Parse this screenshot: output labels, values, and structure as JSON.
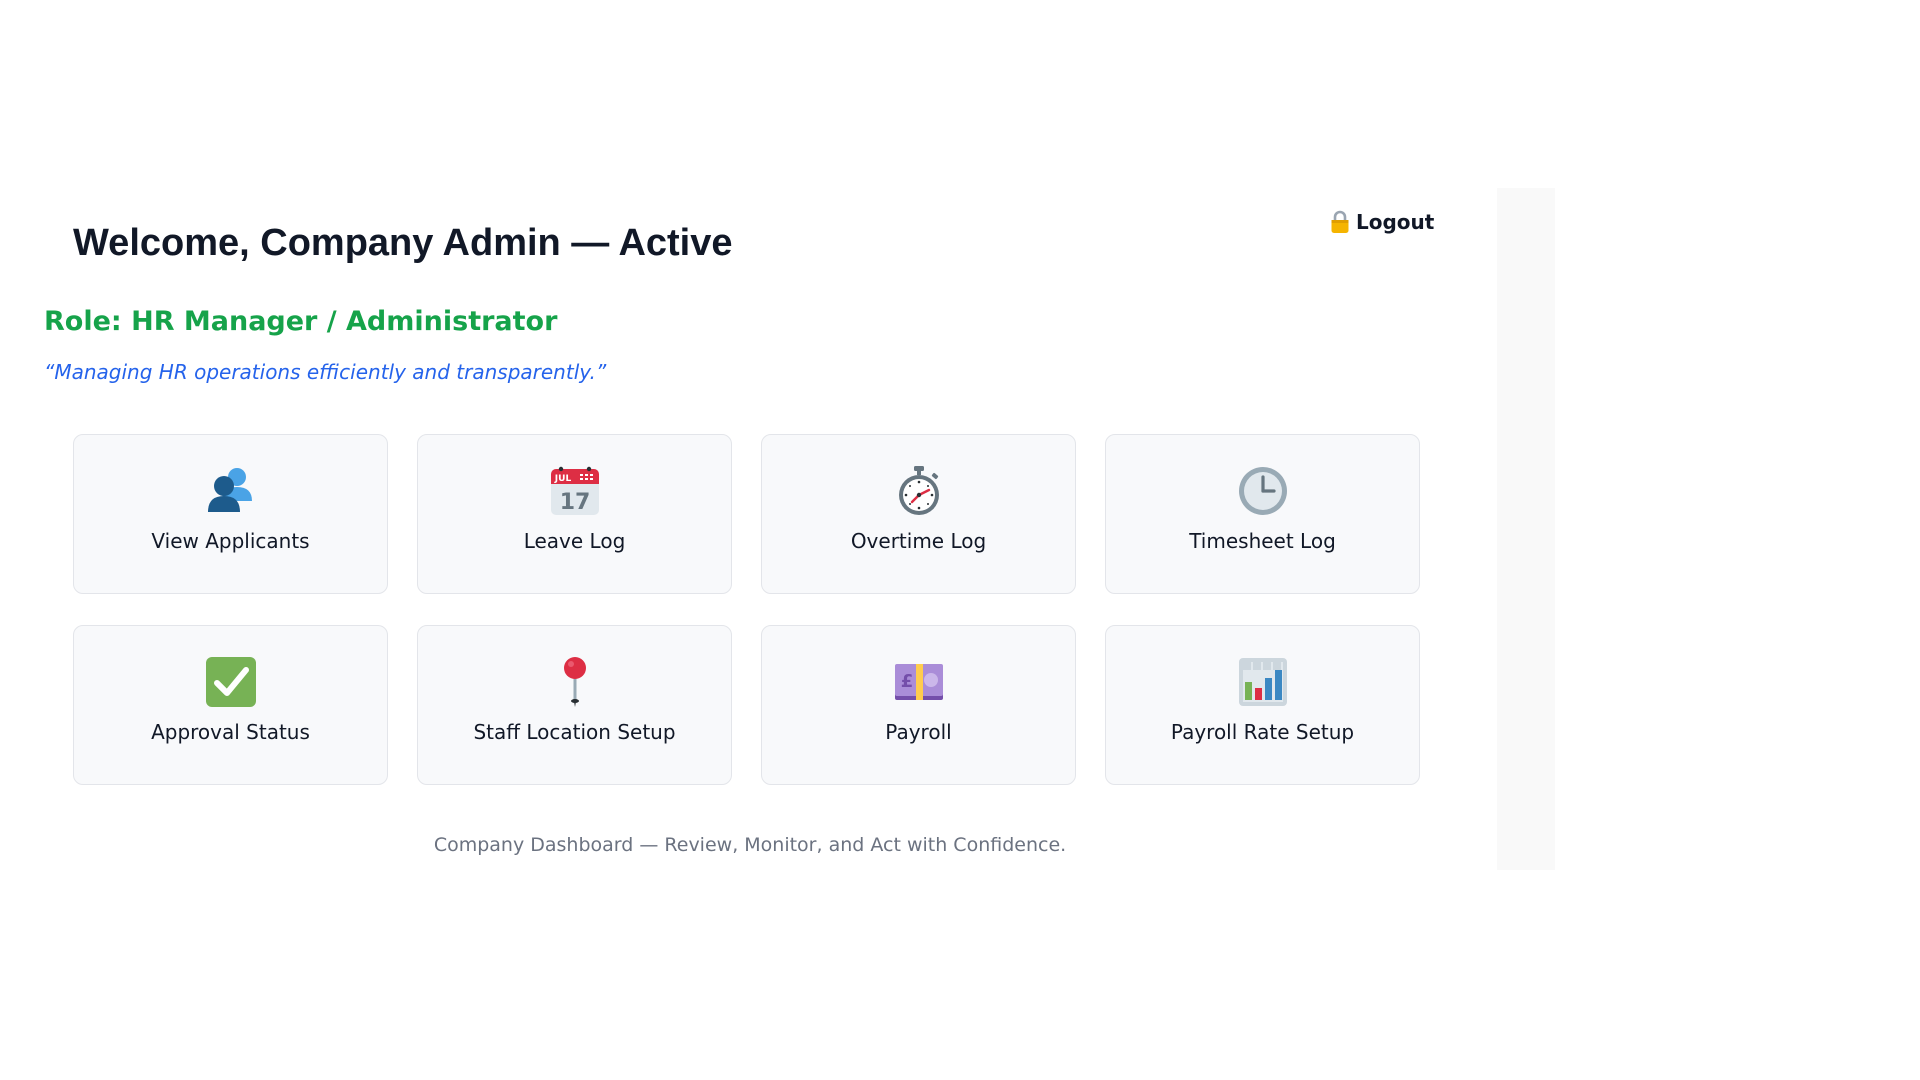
{
  "header": {
    "welcome": "Welcome, Company Admin — Active",
    "logout_label": "Logout",
    "logout_icon": "lock-icon"
  },
  "profile": {
    "role": "Role: HR Manager / Administrator",
    "tagline": "“Managing HR operations efficiently and transparently.”"
  },
  "cards": [
    {
      "label": "View Applicants",
      "icon": "people-icon"
    },
    {
      "label": "Leave Log",
      "icon": "calendar-icon"
    },
    {
      "label": "Overtime Log",
      "icon": "stopwatch-icon"
    },
    {
      "label": "Timesheet Log",
      "icon": "clock-icon"
    },
    {
      "label": "Approval Status",
      "icon": "check-icon"
    },
    {
      "label": "Staff Location Setup",
      "icon": "pushpin-icon"
    },
    {
      "label": "Payroll",
      "icon": "money-icon"
    },
    {
      "label": "Payroll Rate Setup",
      "icon": "bar-chart-icon"
    }
  ],
  "calendar_icon_text": {
    "month": "JUL",
    "day": "17"
  },
  "money_icon_symbol": "£",
  "footer": {
    "text": "Company Dashboard — Review, Monitor, and Act with Confidence."
  },
  "colors": {
    "role": "#16a34a",
    "tagline": "#2563eb",
    "card_bg": "#f8f9fb",
    "card_border": "#e3e5ea",
    "footer": "#6b7280"
  }
}
